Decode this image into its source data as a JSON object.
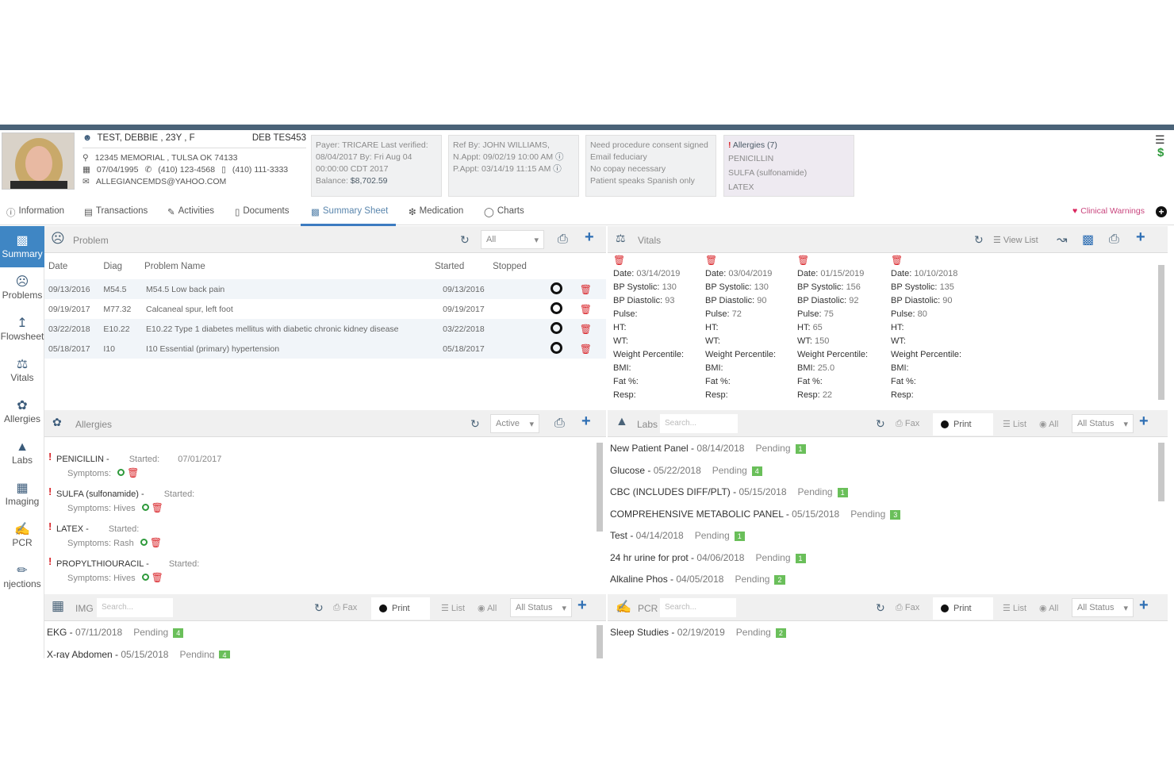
{
  "patient": {
    "name": "TEST, DEBBIE , 23Y , F",
    "id": "DEB TES453",
    "address": "12345 MEMORIAL , TULSA OK 74133",
    "dob": "07/04/1995",
    "phone": "(410) 123-4568",
    "mobile": "(410) 111-3333",
    "email": "ALLEGIANCEMDS@YAHOO.COM"
  },
  "payer_card": {
    "line1": "Payer: TRICARE Last verified:",
    "line2": "08/04/2017 By: Fri Aug 04",
    "line3": "00:00:00 CDT 2017",
    "balance_label": "Balance:",
    "balance": "$8,702.59"
  },
  "ref_card": {
    "ref": "Ref By: JOHN WILLIAMS,",
    "nappt": "N.Appt: 09/02/19 10:00 AM",
    "pappt": "P.Appt: 03/14/19 11:15 AM"
  },
  "notes_card": {
    "lines": [
      "Need procedure consent signed",
      "Email feduciary",
      "No copay necessary",
      "Patient speaks Spanish only"
    ]
  },
  "allergy_card": {
    "title": "Allergies (7)",
    "items": [
      "PENICILLIN",
      "SULFA (sulfonamide)",
      "LATEX"
    ]
  },
  "tabs": [
    "Information",
    "Transactions",
    "Activities",
    "Documents",
    "Summary Sheet",
    "Medication",
    "Charts"
  ],
  "clinical_warnings": "Clinical Warnings",
  "sidebar": [
    "Summary",
    "Problems",
    "Flowsheet",
    "Vitals",
    "Allergies",
    "Labs",
    "Imaging",
    "PCR",
    "njections"
  ],
  "problem_panel": {
    "title": "Problem",
    "filter": "All",
    "headers": [
      "Date",
      "Diag",
      "Problem Name",
      "Started",
      "Stopped"
    ],
    "rows": [
      [
        "09/13/2016",
        "M54.5",
        "M54.5 Low back pain",
        "09/13/2016"
      ],
      [
        "09/19/2017",
        "M77.32",
        "Calcaneal spur, left foot",
        "09/19/2017"
      ],
      [
        "03/22/2018",
        "E10.22",
        "E10.22 Type 1 diabetes mellitus with diabetic chronic kidney disease",
        "03/22/2018"
      ],
      [
        "05/18/2017",
        "I10",
        "I10 Essential (primary) hypertension",
        "05/18/2017"
      ]
    ]
  },
  "vitals_panel": {
    "title": "Vitals",
    "view_list": "View List",
    "columns": [
      {
        "date": "03/14/2019",
        "sys": "130",
        "dia": "93",
        "pulse": "",
        "ht": "",
        "wt": "",
        "bmi": "",
        "resp": ""
      },
      {
        "date": "03/04/2019",
        "sys": "130",
        "dia": "90",
        "pulse": "72",
        "ht": "",
        "wt": "",
        "bmi": "",
        "resp": ""
      },
      {
        "date": "01/15/2019",
        "sys": "156",
        "dia": "92",
        "pulse": "75",
        "ht": "65",
        "wt": "150",
        "bmi": "25.0",
        "resp": "22"
      },
      {
        "date": "10/10/2018",
        "sys": "135",
        "dia": "90",
        "pulse": "80",
        "ht": "",
        "wt": "",
        "bmi": "",
        "resp": ""
      }
    ],
    "labels": {
      "date": "Date:",
      "sys": "BP Systolic:",
      "dia": "BP Diastolic:",
      "pulse": "Pulse:",
      "ht": "HT:",
      "wt": "WT:",
      "wp": "Weight Percentile:",
      "bmi": "BMI:",
      "fat": "Fat %:",
      "resp": "Resp:"
    }
  },
  "allergies_panel": {
    "title": "Allergies",
    "filter": "Active",
    "items": [
      {
        "name": "PENICILLIN -",
        "started": "Started:",
        "date": "07/01/2017",
        "symptoms": "Symptoms:"
      },
      {
        "name": "SULFA (sulfonamide) -",
        "started": "Started:",
        "date": "",
        "symptoms": "Symptoms: Hives"
      },
      {
        "name": "LATEX -",
        "started": "Started:",
        "date": "",
        "symptoms": "Symptoms: Rash"
      },
      {
        "name": "PROPYLTHIOURACIL -",
        "started": "Started:",
        "date": "",
        "symptoms": "Symptoms: Hives"
      }
    ]
  },
  "labs_panel": {
    "title": "Labs",
    "search": "Search...",
    "fax": "Fax",
    "print": "Print",
    "list": "List",
    "all": "All",
    "status": "All Status",
    "items": [
      {
        "name": "New Patient Panel - ",
        "date": "08/14/2018",
        "status": "Pending",
        "n": "1"
      },
      {
        "name": "Glucose - ",
        "date": "05/22/2018",
        "status": "Pending",
        "n": "4"
      },
      {
        "name": "CBC (INCLUDES DIFF/PLT) - ",
        "date": "05/15/2018",
        "status": "Pending",
        "n": "1"
      },
      {
        "name": "COMPREHENSIVE METABOLIC PANEL - ",
        "date": "05/15/2018",
        "status": "Pending",
        "n": "3"
      },
      {
        "name": "Test - ",
        "date": "04/14/2018",
        "status": "Pending",
        "n": "1"
      },
      {
        "name": "24 hr urine for prot - ",
        "date": "04/06/2018",
        "status": "Pending",
        "n": "1"
      },
      {
        "name": "Alkaline Phos - ",
        "date": "04/05/2018",
        "status": "Pending",
        "n": "2"
      }
    ]
  },
  "img_panel": {
    "title": "IMG",
    "search": "Search...",
    "fax": "Fax",
    "print": "Print",
    "list": "List",
    "all": "All",
    "status": "All Status",
    "items": [
      {
        "name": "EKG - ",
        "date": "07/11/2018",
        "status": "Pending",
        "n": "4"
      },
      {
        "name": "X-ray Abdomen - ",
        "date": "05/15/2018",
        "status": "Pending",
        "n": "4"
      }
    ]
  },
  "pcr_panel": {
    "title": "PCR",
    "search": "Search...",
    "fax": "Fax",
    "print": "Print",
    "list": "List",
    "all": "All",
    "status": "All Status",
    "items": [
      {
        "name": "Sleep Studies - ",
        "date": "02/19/2019",
        "status": "Pending",
        "n": "2"
      }
    ]
  },
  "colors": {
    "accent": "#3f86c4",
    "header_bar": "#4a6378",
    "danger": "#d9262b",
    "badge": "#6abf5a"
  }
}
